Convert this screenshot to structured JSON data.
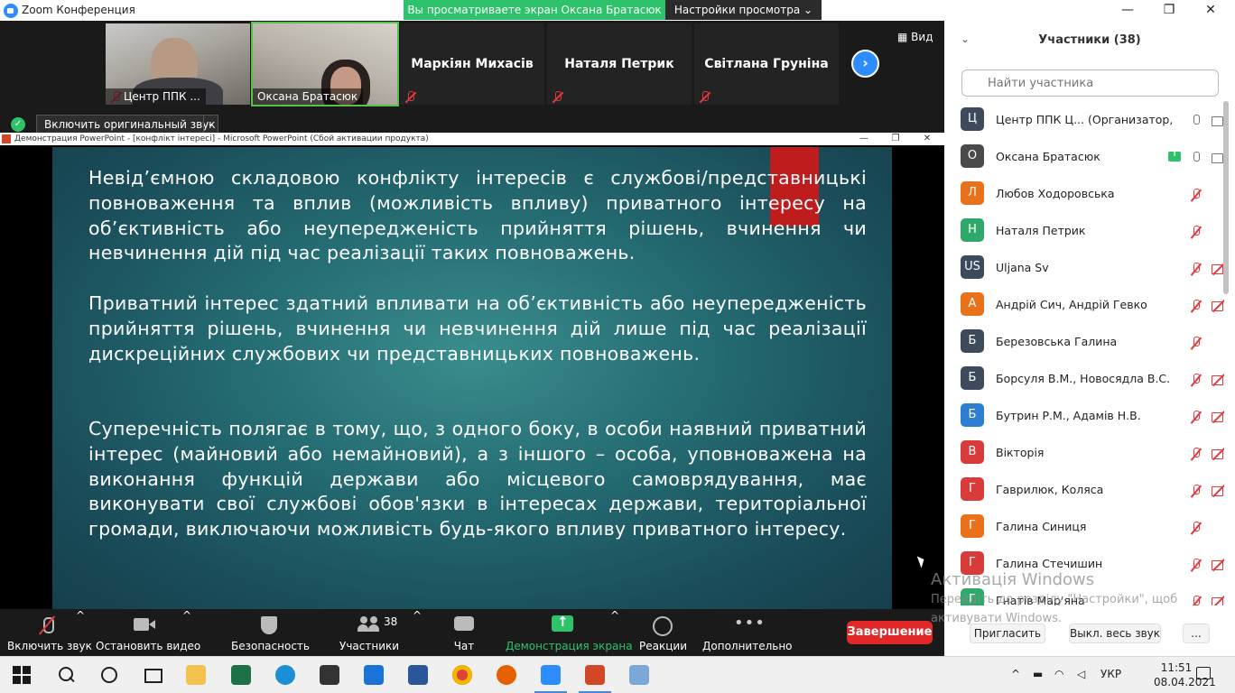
{
  "window": {
    "title": "Zoom Конференция",
    "share_banner": "Вы просматриваете экран Оксана Братасюк",
    "view_settings": "Настройки просмотра ⌄",
    "minimize": "—",
    "maximize": "❐",
    "close": "✕"
  },
  "video_strip": {
    "tiles": [
      {
        "name": "Центр ППК ...",
        "type": "camera"
      },
      {
        "name": "Оксана Братасюк",
        "type": "camera"
      },
      {
        "name": "Маркіян Михасів",
        "type": "name"
      },
      {
        "name": "Наталя Петрик",
        "type": "name"
      },
      {
        "name": "Світлана Груніна",
        "type": "name"
      }
    ],
    "next_label": "›",
    "view_label": "Вид",
    "original_sound_label": "Включить оригинальный звук",
    "original_sound_dd": "⌄",
    "shield_badge": "✓"
  },
  "ppt": {
    "title": "Демонстрация PowerPoint - [конфлікт інтересі] - Microsoft PowerPoint (Сбой активации продукта)",
    "minimize": "—",
    "maximize": "❐",
    "close": "✕"
  },
  "slide": {
    "paragraphs": [
      "Невід’ємною складовою конфлікту інтересів є службові/представницькі повноваження та вплив (можливість впливу) приватного інтересу на об’єктивність або неупередженість прийняття рішень, вчинення чи невчинення дій під час реалізації таких повноважень.",
      "Приватний інтерес здатний впливати на об’єктивність або неупередженість прийняття рішень, вчинення чи невчинення дій лише під час реалізації дискреційних службових чи представницьких повноважень.",
      "Суперечність полягає в тому, що, з одного боку, в особи наявний приватний інтерес (майновий або немайновий), а з іншого – особа, уповноважена на виконання функцій держави або місцевого самоврядування, має виконувати свої службові обов'язки в інтересах держави, територіальної громади, виключаючи можливість будь-якого впливу приватного інтересу."
    ]
  },
  "toolbar": {
    "unmute": "Включить звук",
    "stop_video": "Остановить видео",
    "security": "Безопасность",
    "participants": "Участники",
    "participants_count": "38",
    "chat": "Чат",
    "share_screen": "Демонстрация экрана",
    "reactions": "Реакции",
    "more": "Дополнительно",
    "more_dots": "•••",
    "caret": "^",
    "end": "Завершение"
  },
  "panel": {
    "collapse": "⌄",
    "title": "Участники (38)",
    "search_placeholder": "Найти участника",
    "participants": [
      {
        "initial": "Ц",
        "color": "#3d4a5c",
        "name": "Центр ППК Ц... (Организатор, я)",
        "share": false,
        "mic": "on",
        "cam": "on"
      },
      {
        "initial": "О",
        "color": "#4a4a4a",
        "name": "Оксана Братасюк",
        "share": true,
        "mic": "on",
        "cam": "on"
      },
      {
        "initial": "Л",
        "color": "#e8711a",
        "name": "Любов Ходоровська",
        "share": false,
        "mic": "off",
        "cam": "none"
      },
      {
        "initial": "Н",
        "color": "#2ea86b",
        "name": "Наталя Петрик",
        "share": false,
        "mic": "off",
        "cam": "none"
      },
      {
        "initial": "US",
        "color": "#3d4a5c",
        "name": "Uljana Sv",
        "share": false,
        "mic": "off",
        "cam": "off"
      },
      {
        "initial": "А",
        "color": "#e8711a",
        "name": "Андрій Сич, Андрій Гевко",
        "share": false,
        "mic": "off",
        "cam": "off"
      },
      {
        "initial": "Б",
        "color": "#3d4a5c",
        "name": "Березовська Галина",
        "share": false,
        "mic": "off",
        "cam": "none"
      },
      {
        "initial": "Б",
        "color": "#3d4a5c",
        "name": "Борсуля В.М., Новосядла В.С.",
        "share": false,
        "mic": "off",
        "cam": "off"
      },
      {
        "initial": "Б",
        "color": "#2d7dd2",
        "name": "Бутрин Р.М., Адамів Н.В.",
        "share": false,
        "mic": "off",
        "cam": "off"
      },
      {
        "initial": "В",
        "color": "#d93a3a",
        "name": "Вікторія",
        "share": false,
        "mic": "off",
        "cam": "off"
      },
      {
        "initial": "Г",
        "color": "#d93a3a",
        "name": "Гаврилюк, Коляса",
        "share": false,
        "mic": "off",
        "cam": "off"
      },
      {
        "initial": "Г",
        "color": "#e8711a",
        "name": "Галина Синиця",
        "share": false,
        "mic": "off",
        "cam": "none"
      },
      {
        "initial": "Г",
        "color": "#d93a3a",
        "name": "Галина Стечишин",
        "share": false,
        "mic": "off",
        "cam": "off"
      },
      {
        "initial": "Г",
        "color": "#2ea86b",
        "name": "Гнатів Мар'яна",
        "share": false,
        "mic": "off",
        "cam": "off"
      }
    ],
    "invite": "Пригласить",
    "mute_all": "Выкл. весь звук",
    "more": "..."
  },
  "watermark": {
    "title": "Активація Windows",
    "line1": "Перейдіть до розділу \"Настройки\", щоб",
    "line2": "активувати Windows."
  },
  "taskbar": {
    "tray_arrow": "^",
    "language": "УКР",
    "time": "11:51",
    "date": "08.04.2021"
  }
}
